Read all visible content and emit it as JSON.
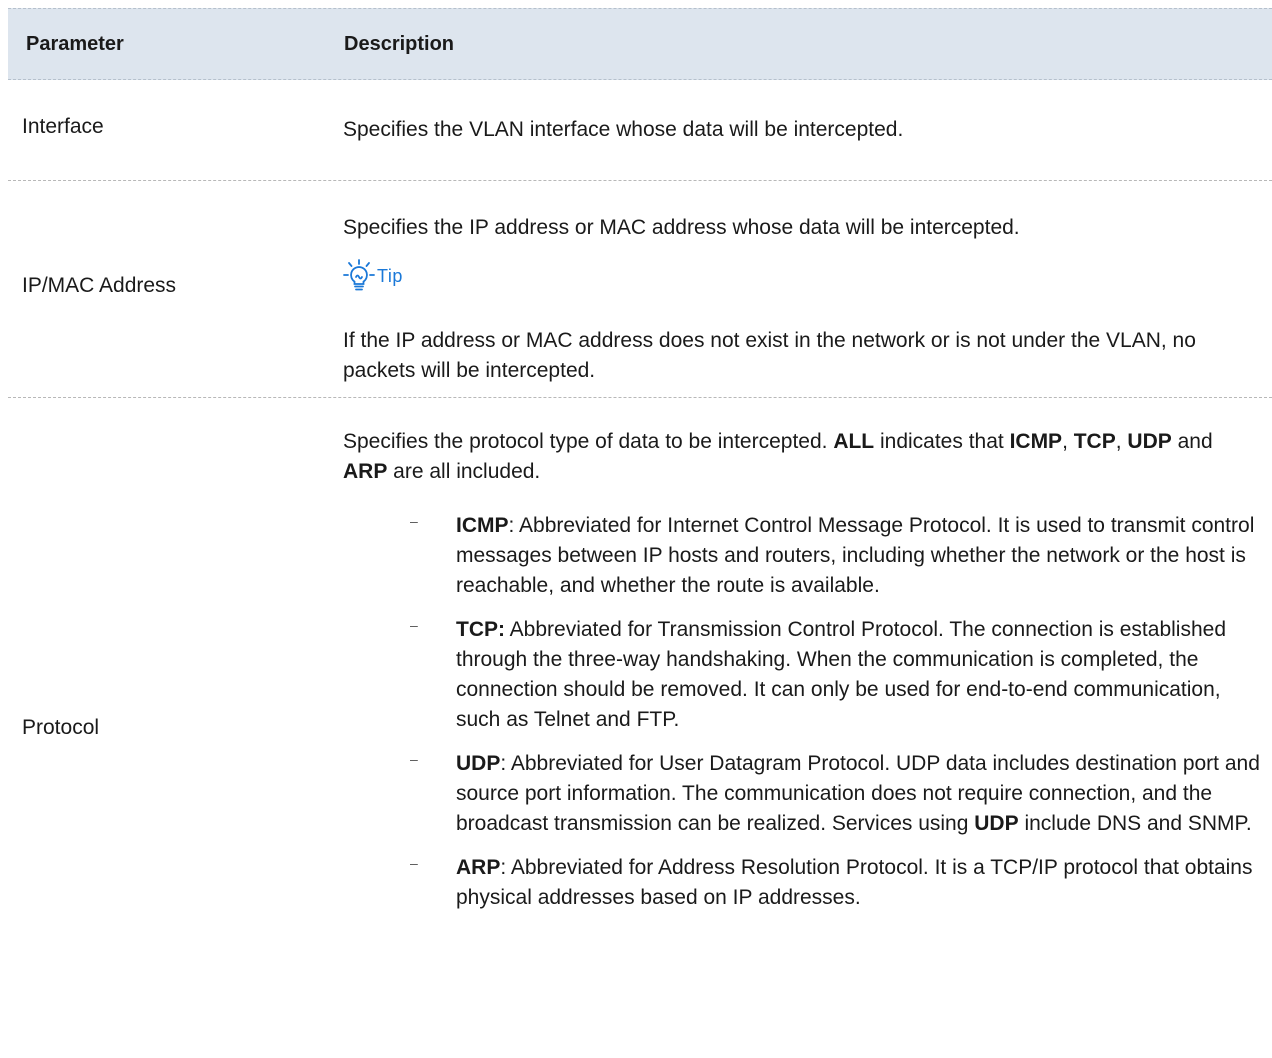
{
  "header": {
    "parameter": "Parameter",
    "description": "Description"
  },
  "rows": {
    "interface": {
      "param": "Interface",
      "desc": "Specifies the VLAN interface whose data will be intercepted."
    },
    "ipmac": {
      "param": "IP/MAC Address",
      "desc1": "Specifies the IP address or MAC address whose data will be intercepted.",
      "tip_label": "Tip",
      "desc2": "If the IP address or MAC address does not exist in the network or is not under the VLAN, no packets will be intercepted."
    },
    "protocol": {
      "param": "Protocol",
      "intro": {
        "t1": "Specifies the protocol type of data to be intercepted. ",
        "all": "ALL",
        "t2": " indicates that ",
        "icmp": "ICMP",
        "c1": ", ",
        "tcp": "TCP",
        "c2": ", ",
        "udp": "UDP",
        "t3": " and ",
        "arp": "ARP",
        "t4": " are all included."
      },
      "bullets": {
        "icmp": {
          "term": "ICMP",
          "text": ": Abbreviated for Internet Control Message Protocol. It is used to transmit control messages between IP hosts and routers, including whether the network or the host is reachable, and whether the route is available."
        },
        "tcp": {
          "term": "TCP:",
          "text": " Abbreviated for Transmission Control Protocol. The connection is established through the three-way handshaking. When the communication is completed, the connection should be removed. It can only be used for end-to-end communication, such as Telnet and FTP."
        },
        "udp": {
          "term": "UDP",
          "text1": ": Abbreviated for User Datagram Protocol. UDP data includes destination port and source port information. The communication does not require connection, and the broadcast transmission can be realized. Services using ",
          "term2": "UDP",
          "text2": " include DNS and SNMP."
        },
        "arp": {
          "term": "ARP",
          "text": ": Abbreviated for Address Resolution Protocol. It is a TCP/IP protocol that obtains physical addresses based on IP addresses."
        }
      }
    }
  },
  "bullet_marker": "–",
  "colors": {
    "header_bg": "#dde5ee",
    "tip": "#1a78d8",
    "text": "#1a1a1a"
  },
  "icons": {
    "tip": "lightbulb-icon"
  }
}
